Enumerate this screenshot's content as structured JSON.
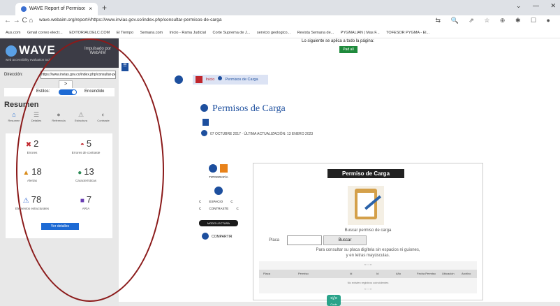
{
  "browser": {
    "tab_title": "WAVE Report of Permisos de Ca",
    "tab_close": "×",
    "new_tab": "+",
    "window_controls": "⌄ — ✕",
    "nav_icons": "← → C ⌂",
    "url": "wave.webaim.org/report#/https://www.invias.gov.co/index.php/consultar-permisos-de-carga",
    "extensions": "⇆ 🔍 ⇗ ☆ ⊕ ✱ ☐ ●"
  },
  "bookmarks": [
    "Aus.com",
    "Gmail correo electr...",
    "EDITORIALDELC.COM",
    "El Tiempo",
    "Semana.com",
    "Inicio - Rama Judicial",
    "Corte Suprema de J...",
    "servicio geologico...",
    "Revista Semana de...",
    "PYGMALIAN | Mas F...",
    "TOFESOR PYGMA - El..."
  ],
  "wave": {
    "logo": "WAVE",
    "tagline": "web accessibility evaluation tool",
    "powered": "Impulsado por WebAIM",
    "address_label": "Dirección:",
    "address_value": "https://www.invias.gov.co/index.php/consultar-permisos",
    "go": ">",
    "styles_label": "Estilos:",
    "styles_state": "Encendido",
    "summary_title": "Resumen",
    "tabs": [
      {
        "label": "Resumen",
        "icon": "⌂"
      },
      {
        "label": "Detalles",
        "icon": "☰"
      },
      {
        "label": "Referencia",
        "icon": "●"
      },
      {
        "label": "Estructura",
        "icon": "⚠"
      },
      {
        "label": "Contraste",
        "icon": "◐"
      }
    ],
    "summary": [
      {
        "num": "2",
        "label": "Errores",
        "mark": "✖",
        "color": "#c0262c"
      },
      {
        "num": "5",
        "label": "Errores de contraste",
        "mark": "◓",
        "color": "#c0262c"
      },
      {
        "num": "18",
        "label": "Alertas",
        "mark": "▲",
        "color": "#d98c1b"
      },
      {
        "num": "13",
        "label": "Características",
        "mark": "●",
        "color": "#2e8b57"
      },
      {
        "num": "78",
        "label": "Elementos estructurales",
        "mark": "⚠",
        "color": "#3b6fd1"
      },
      {
        "num": "7",
        "label": "ARIA",
        "mark": "■",
        "color": "#6a3fb3"
      }
    ],
    "view_details": "Ver detalles"
  },
  "page": {
    "consent_text": "Lo siguiente se aplica a todo la página:",
    "consent_btn": "Pad aIl",
    "toggle_icon": "☰",
    "breadcrumb_home": "Inicio",
    "breadcrumb_current": "Permisos de Carga",
    "title": "Permisos de Carga",
    "meta": "07 OCTUBRE 2017 · ÚLTIMA ACTUALIZACIÓN: 13 ENERO 2023",
    "tools_label": "TIPOGRAFÍA",
    "tools_row1": "C ESPACIO C",
    "tools_row2": "C CONTRASTE C",
    "reading_mode": "MODO LECTURA",
    "share": "COMPARTIR",
    "panel_title": "Permiso de Carga",
    "search_title": "Buscar permiso de carga",
    "placa_label": "Placa",
    "search_btn": "Buscar",
    "help_line1": "Para consultar su placa digítela sin espacios ni guiones,",
    "help_line2": "y en letras mayúsculas.",
    "pager_top": "« ‹ › »",
    "columns": [
      "Placa",
      "Permiso",
      "Id",
      "Id",
      "Año",
      "Fecha Permiso",
      "Ubicación",
      "Archivo"
    ],
    "no_records": "No existen registros coincidentes",
    "pager_bottom": "« ‹ › »",
    "code_fab": "</>",
    "code_fab_label": "Code"
  }
}
